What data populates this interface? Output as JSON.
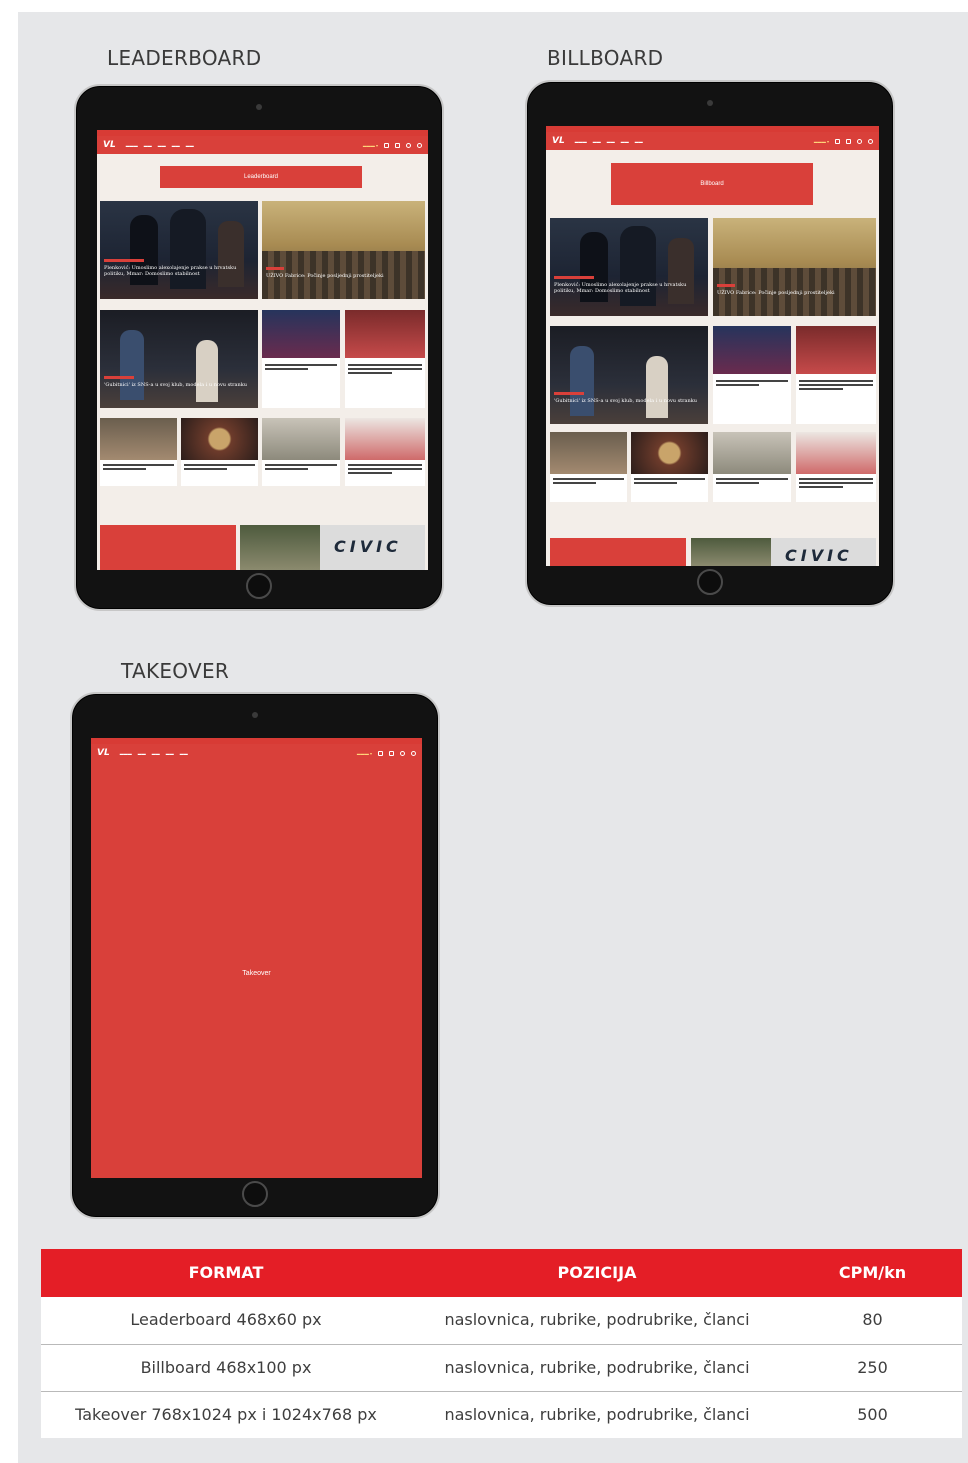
{
  "sections": {
    "leaderboard": {
      "title": "LEADERBOARD",
      "ad_label": "Leaderboard",
      "logo": "VL",
      "headlines": {
        "hero_left": "Plenković: Umoslimo alexolajenje prakse u hrvatsku politiku, Mmar: Domoslimo stabilnost",
        "hero_right": "UŽIVO Fabrice: Počinje posljednji prostiteljeki",
        "second_left": "'Gubitnici' iz SNS-a u svoj klub, modela i u novu stranku"
      },
      "civic_text": "CIVIC"
    },
    "billboard": {
      "title": "BILLBOARD",
      "ad_label": "Billboard",
      "logo": "VL",
      "headlines": {
        "hero_left": "Plenković: Umoslimo alexolajenje prakse u hrvatsku politiku, Mmar: Domoslimo stabilnost",
        "hero_right": "UŽIVO Fabrice: Počinje posljednji prostiteljeki",
        "second_left": "'Gubitnici' iz SNS-a u svoj klub, modela i u novu stranku"
      },
      "civic_text": "CIVIC"
    },
    "takeover": {
      "title": "TAKEOVER",
      "ad_label": "Takeover",
      "logo": "VL"
    }
  },
  "table": {
    "headers": [
      "FORMAT",
      "POZICIJA",
      "CPM/kn"
    ],
    "rows": [
      {
        "format": "Leaderboard 468x60 px",
        "position": "naslovnica, rubrike, podrubrike, članci",
        "cpm": "80"
      },
      {
        "format": "Billboard 468x100 px",
        "position": "naslovnica, rubrike, podrubrike, članci",
        "cpm": "250"
      },
      {
        "format": "Takeover 768x1024 px i 1024x768 px",
        "position": "naslovnica, rubrike, podrubrike, članci",
        "cpm": "500"
      }
    ]
  },
  "colors": {
    "panel_bg": "#e6e7e9",
    "brand_red": "#d9403a",
    "table_header_red": "#e41e26",
    "device_black": "#121212"
  }
}
